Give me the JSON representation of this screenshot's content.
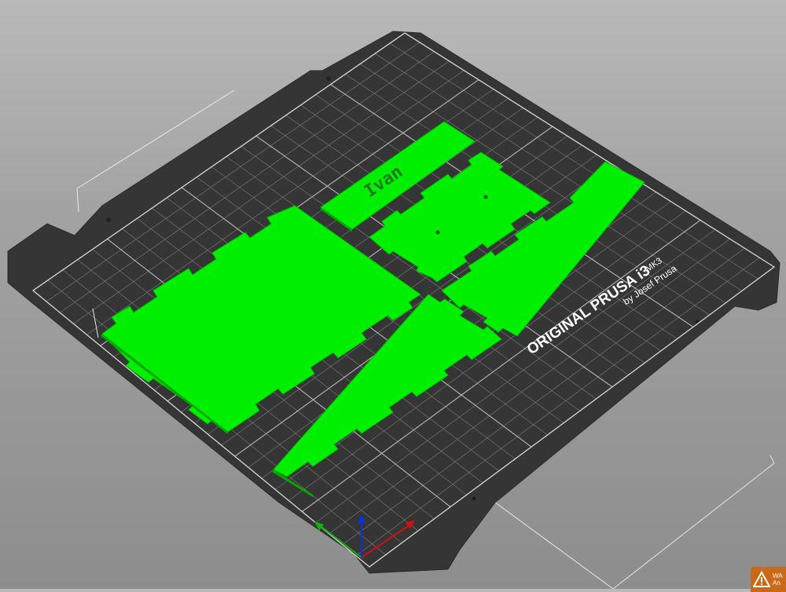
{
  "bed": {
    "brand_line": "ORIGINAL PRUSA i3",
    "model": "MK3",
    "byline": "by Josef Prusa"
  },
  "objects": [
    {
      "name": "large-square-panel",
      "selected": true
    },
    {
      "name": "name-plate",
      "engraving": "Ivan",
      "selected": true
    },
    {
      "name": "small-panel-with-holes",
      "selected": true
    },
    {
      "name": "long-triangle-right",
      "selected": true
    },
    {
      "name": "long-triangle-bottom",
      "selected": true
    }
  ],
  "colors": {
    "part": "#00ee00",
    "part_edge": "#00b800",
    "bed": "#3a3a3a",
    "grid": "#9a9a9a",
    "axis_x": "#d01010",
    "axis_y": "#10b010",
    "axis_z": "#1030d0",
    "warning": "#c86a1a"
  },
  "notification": {
    "type": "warning",
    "line1": "WA",
    "line2": "An"
  }
}
